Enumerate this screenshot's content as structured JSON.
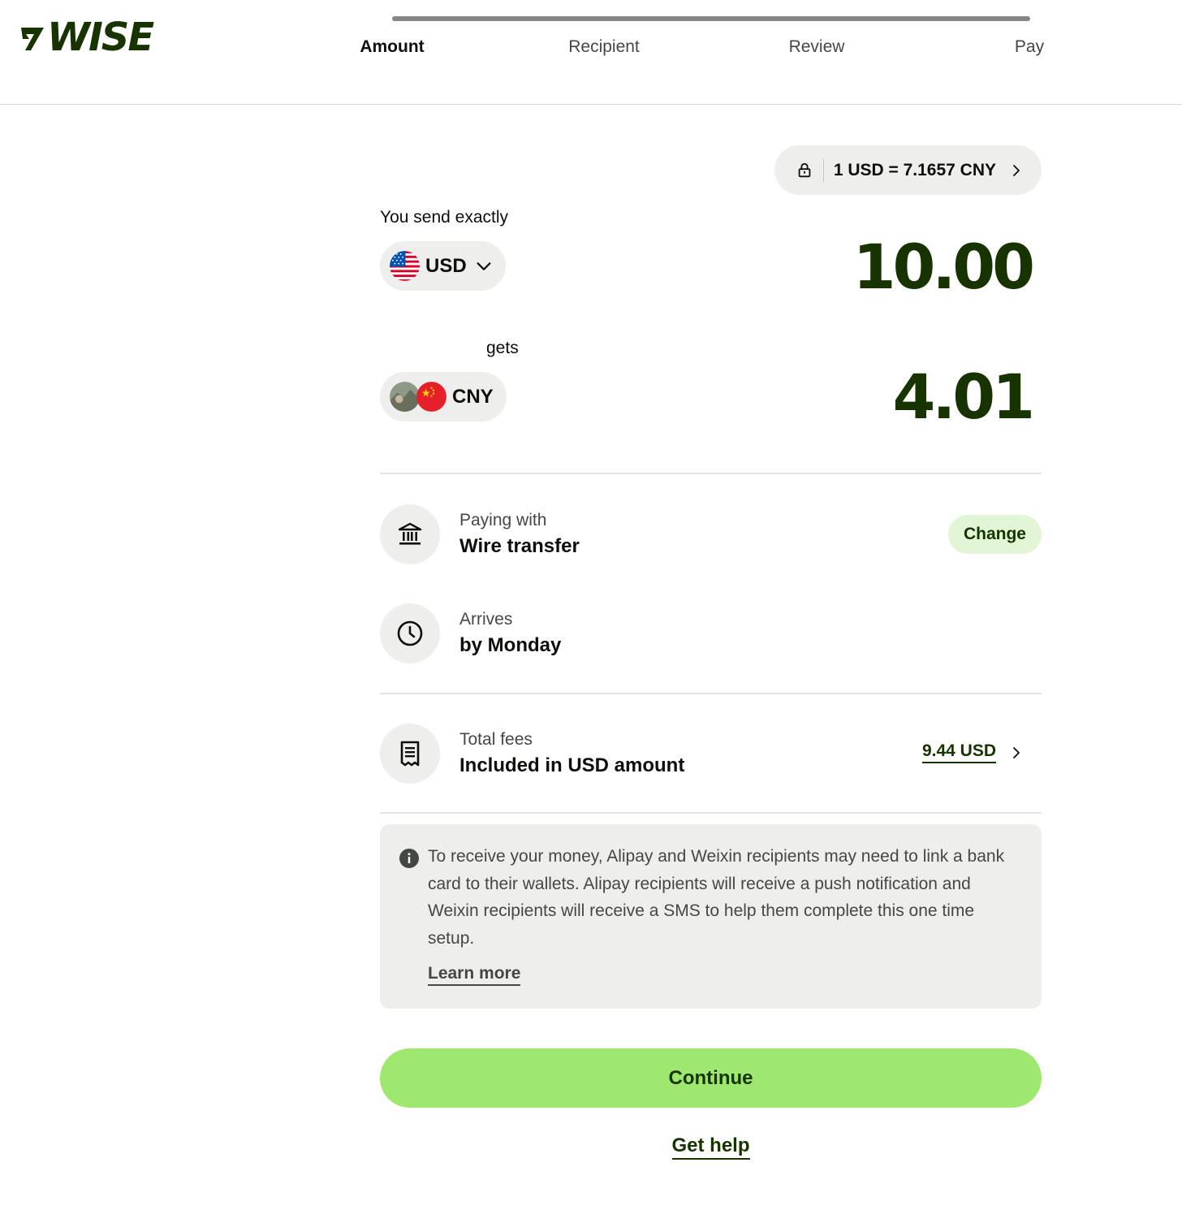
{
  "header": {
    "logo_text": "WISE",
    "progress": 1.0,
    "steps": [
      {
        "label": "Amount",
        "active": true
      },
      {
        "label": "Recipient",
        "active": false
      },
      {
        "label": "Review",
        "active": false
      },
      {
        "label": "Pay",
        "active": false
      }
    ]
  },
  "rate": {
    "text": "1 USD = 7.1657 CNY",
    "lock_icon": "lock-icon",
    "chevron_icon": "chevron-right-icon"
  },
  "send": {
    "label": "You send exactly",
    "currency": "USD",
    "flag_icon": "us-flag-icon",
    "amount": "10.00"
  },
  "receive": {
    "label": "gets",
    "currency": "CNY",
    "flag_icon": "china-flag-icon",
    "amount": "4.01"
  },
  "paying": {
    "sub": "Paying with",
    "main": "Wire transfer",
    "icon": "bank-icon",
    "change_label": "Change"
  },
  "arrives": {
    "sub": "Arrives",
    "main": "by Monday",
    "icon": "clock-icon"
  },
  "fees": {
    "sub": "Total fees",
    "main": "Included in USD amount",
    "amount": "9.44 USD",
    "icon": "receipt-icon"
  },
  "notice": {
    "text": "To receive your money, Alipay and Weixin recipients may need to link a bank card to their wallets. Alipay recipients will receive a push notification and Weixin recipients will receive a SMS to help them complete this one time setup.",
    "learn_more": "Learn more",
    "icon": "info-icon"
  },
  "actions": {
    "continue_label": "Continue",
    "help_label": "Get help"
  },
  "colors": {
    "brand_dark": "#163300",
    "accent_green": "#9fe870",
    "light_green": "#e2f6d5",
    "surface": "#eeefec"
  }
}
